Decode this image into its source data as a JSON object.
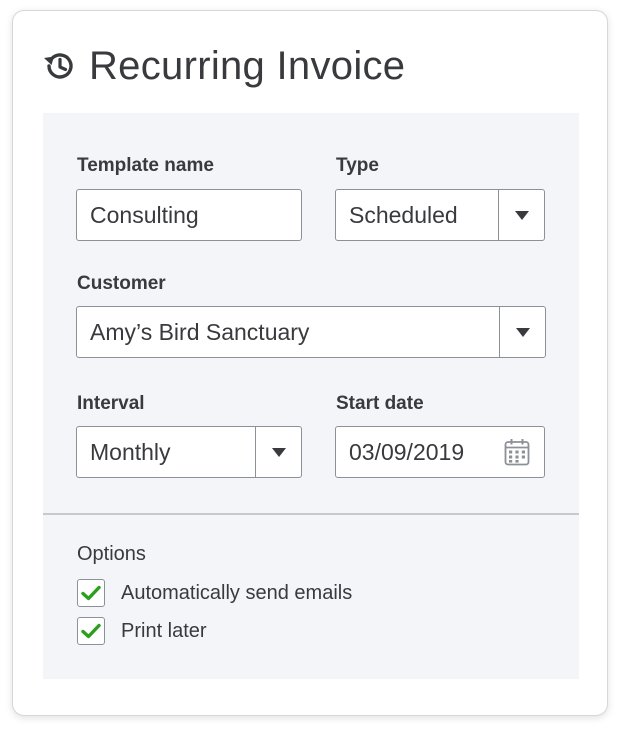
{
  "header": {
    "icon": "history-icon",
    "title": "Recurring Invoice"
  },
  "form": {
    "template_name": {
      "label": "Template name",
      "value": "Consulting"
    },
    "type": {
      "label": "Type",
      "value": "Scheduled"
    },
    "customer": {
      "label": "Customer",
      "value": "Amy’s Bird Sanctuary"
    },
    "interval": {
      "label": "Interval",
      "value": "Monthly"
    },
    "start_date": {
      "label": "Start date",
      "value": "03/09/2019",
      "icon": "calendar-icon"
    }
  },
  "options": {
    "heading": "Options",
    "items": [
      {
        "label": "Automatically send emails",
        "checked": true
      },
      {
        "label": "Print later",
        "checked": true
      }
    ]
  },
  "colors": {
    "text": "#393a3d",
    "border": "#8d9096",
    "panel_bg": "#f4f5f8",
    "check_green": "#2ca01c"
  }
}
